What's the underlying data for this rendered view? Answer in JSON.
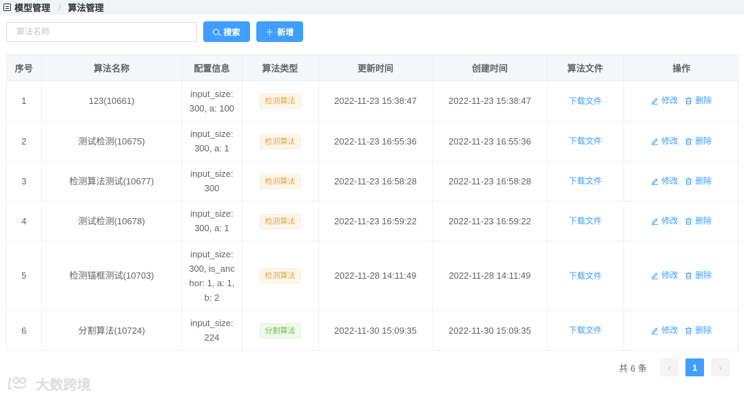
{
  "breadcrumb": {
    "parent": "模型管理",
    "separator": "/",
    "current": "算法管理"
  },
  "toolbar": {
    "search_placeholder": "算法名称",
    "search_value": "",
    "search_label": "搜索",
    "add_label": "新增"
  },
  "table": {
    "headers": [
      "序号",
      "算法名称",
      "配置信息",
      "算法类型",
      "更新时间",
      "创建时间",
      "算法文件",
      "操作"
    ],
    "rows": [
      {
        "index": "1",
        "name": "123(10661)",
        "config": "input_size: 300, a: 100",
        "type": "检测算法",
        "type_kind": "warn",
        "updated": "2022-11-23 15:38:47",
        "created": "2022-11-23 15:38:47",
        "file": "下载文件",
        "edit": "修改",
        "delete": "删除"
      },
      {
        "index": "2",
        "name": "测试检测(10675)",
        "config": "input_size: 300, a: 1",
        "type": "检测算法",
        "type_kind": "warn",
        "updated": "2022-11-23 16:55:36",
        "created": "2022-11-23 16:55:36",
        "file": "下载文件",
        "edit": "修改",
        "delete": "删除"
      },
      {
        "index": "3",
        "name": "检测算法测试(10677)",
        "config": "input_size: 300",
        "type": "检测算法",
        "type_kind": "warn",
        "updated": "2022-11-23 16:58:28",
        "created": "2022-11-23 16:58:28",
        "file": "下载文件",
        "edit": "修改",
        "delete": "删除"
      },
      {
        "index": "4",
        "name": "测试检测(10678)",
        "config": "input_size: 300, a: 1",
        "type": "检测算法",
        "type_kind": "warn",
        "updated": "2022-11-23 16:59:22",
        "created": "2022-11-23 16:59:22",
        "file": "下载文件",
        "edit": "修改",
        "delete": "删除"
      },
      {
        "index": "5",
        "name": "检测锚框测试(10703)",
        "config": "input_size: 300, is_anchor: 1, a: 1, b: 2",
        "type": "检测算法",
        "type_kind": "warn",
        "updated": "2022-11-28 14:11:49",
        "created": "2022-11-28 14:11:49",
        "file": "下载文件",
        "edit": "修改",
        "delete": "删除"
      },
      {
        "index": "6",
        "name": "分割算法(10724)",
        "config": "input_size: 224",
        "type": "分割算法",
        "type_kind": "success",
        "updated": "2022-11-30 15:09:35",
        "created": "2022-11-30 15:09:35",
        "file": "下载文件",
        "edit": "修改",
        "delete": "删除"
      }
    ]
  },
  "pagination": {
    "total_text": "共 6 条",
    "current_page": "1",
    "prev_icon": "chevron-left-icon",
    "next_icon": "chevron-right-icon"
  },
  "watermark": {
    "text": "大数跨境"
  },
  "colors": {
    "primary": "#409eff",
    "warning_tag": "#e6a23c",
    "success_tag": "#67c23a",
    "header_bg": "#f5f7fa"
  }
}
